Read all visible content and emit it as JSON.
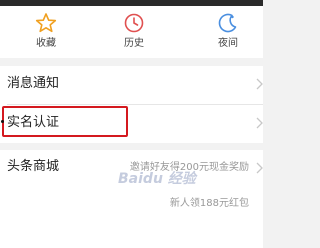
{
  "quick_links": [
    {
      "label": "收藏",
      "icon": "star-icon",
      "color": "#f0a020"
    },
    {
      "label": "历史",
      "icon": "clock-icon",
      "color": "#e05050"
    },
    {
      "label": "夜间",
      "icon": "moon-icon",
      "color": "#4a8fe0"
    }
  ],
  "menu": {
    "notifications": "消息通知",
    "verification": "实名认证",
    "mall": "头条商城",
    "invite_promo": "邀请好友得200元现金奖励",
    "newcomer_promo": "新人领188元红包"
  },
  "watermark": "Baidu 经验",
  "colors": {
    "highlight": "#d4191f"
  }
}
